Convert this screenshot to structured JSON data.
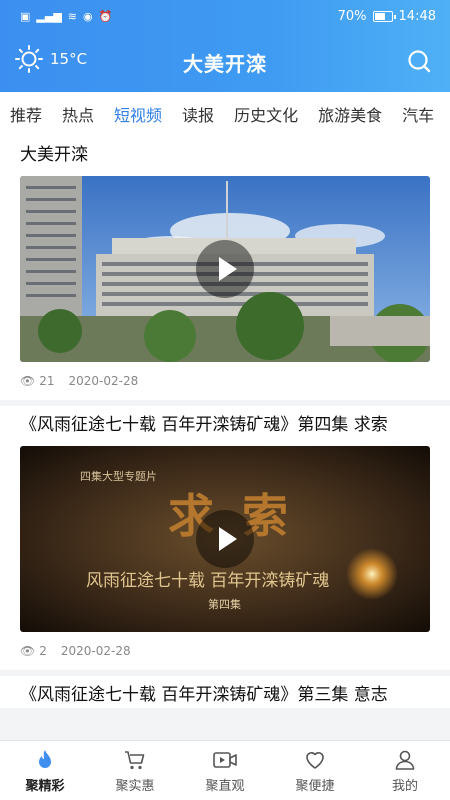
{
  "status_bar": {
    "battery": "70%",
    "battery_level": 0.7,
    "time": "14:48"
  },
  "app_bar": {
    "weather": {
      "icon": "sun-icon",
      "temp": "15°C"
    },
    "title": "大美开滦",
    "search_icon": "search-icon"
  },
  "tabs": [
    {
      "label": "推荐"
    },
    {
      "label": "热点"
    },
    {
      "label": "短视频",
      "active": true
    },
    {
      "label": "读报"
    },
    {
      "label": "历史文化"
    },
    {
      "label": "旅游美食"
    },
    {
      "label": "汽车"
    }
  ],
  "feed": [
    {
      "title": "大美开滦",
      "views": "21",
      "date": "2020-02-28"
    },
    {
      "title": "《风雨征途七十载 百年开滦铸矿魂》第四集 求索",
      "views": "2",
      "date": "2020-02-28",
      "poster": {
        "top_line": "四集大型专题片",
        "main": "求索",
        "sub": "风雨征途七十载 百年开滦铸矿魂",
        "episode": "第四集"
      }
    },
    {
      "title": "《风雨征途七十载 百年开滦铸矿魂》第三集 意志"
    }
  ],
  "bottom_nav": [
    {
      "label": "聚精彩",
      "icon": "flame-icon",
      "active": true
    },
    {
      "label": "聚实惠",
      "icon": "cart-icon"
    },
    {
      "label": "聚直观",
      "icon": "video-icon"
    },
    {
      "label": "聚便捷",
      "icon": "heart-icon"
    },
    {
      "label": "我的",
      "icon": "person-icon"
    }
  ],
  "colors": {
    "accent": "#2f7fe6",
    "header": "#3f9bf2"
  }
}
